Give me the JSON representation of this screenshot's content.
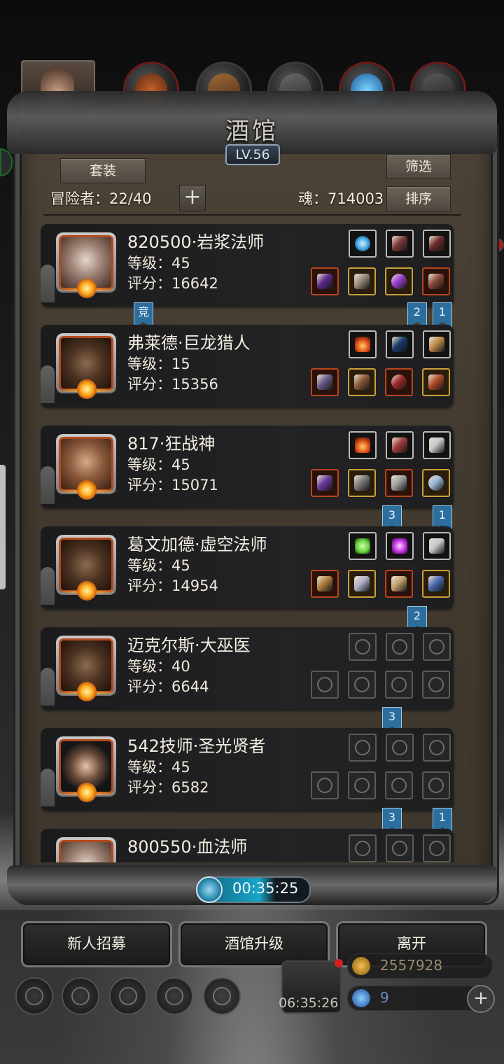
{
  "title": "酒馆",
  "level_badge": "LV.56",
  "buttons": {
    "suit": "套装",
    "filter": "筛选",
    "sort": "排序",
    "plus": "+"
  },
  "stats": {
    "adventurers": "冒险者：22/40",
    "soul": "魂：714003"
  },
  "heroes": [
    {
      "name": "820500·岩浆法师",
      "level": "等级：45",
      "score": "评分：16642",
      "slots_top": [
        {
          "frame": "b",
          "icon": "orb-icon",
          "color": "#3aa0e0"
        },
        {
          "frame": "b",
          "icon": "feather-icon",
          "color": "#7a3a3a"
        },
        {
          "frame": "b",
          "icon": "feather-icon",
          "color": "#6a2a2a"
        }
      ],
      "slots_bottom": [
        {
          "frame": "r",
          "icon": "staff-icon",
          "color": "#5a2a8a"
        },
        {
          "frame": "g",
          "icon": "armor-icon",
          "color": "#9a8a7a"
        },
        {
          "frame": "g",
          "icon": "eye-ring-icon",
          "color": "#9a40d0"
        },
        {
          "frame": "r",
          "icon": "book-icon",
          "color": "#8a4a3a"
        }
      ]
    },
    {
      "name": "弗莱德·巨龙猎人",
      "level": "等级：15",
      "score": "评分：15356",
      "slots_top": [
        {
          "frame": "b",
          "icon": "fire-icon",
          "color": "#e0501a"
        },
        {
          "frame": "b",
          "icon": "bow-icon",
          "color": "#1a3a6a"
        },
        {
          "frame": "b",
          "icon": "bell-icon",
          "color": "#c08a4a"
        }
      ],
      "slots_bottom": [
        {
          "frame": "r",
          "icon": "crossbow-icon",
          "color": "#6a5a8a"
        },
        {
          "frame": "g",
          "icon": "armor-icon",
          "color": "#8a5a3a"
        },
        {
          "frame": "r",
          "icon": "ring-icon",
          "color": "#9a2a2a"
        },
        {
          "frame": "g",
          "icon": "amulet-icon",
          "color": "#b04a2a"
        }
      ]
    },
    {
      "name": "817·狂战神",
      "level": "等级：45",
      "score": "评分：15071",
      "slots_top": [
        {
          "frame": "b",
          "icon": "fire-icon",
          "color": "#e0501a"
        },
        {
          "frame": "b",
          "icon": "feather-icon",
          "color": "#a03a3a"
        },
        {
          "frame": "b",
          "icon": "emblem-icon",
          "color": "#c8c8c8"
        }
      ],
      "slots_bottom": [
        {
          "frame": "r",
          "icon": "axe-icon",
          "color": "#6a3a9a"
        },
        {
          "frame": "g",
          "icon": "armor-icon",
          "color": "#7a7a7a"
        },
        {
          "frame": "r",
          "icon": "helmet-icon",
          "color": "#a0a0a0"
        },
        {
          "frame": "g",
          "icon": "medallion-icon",
          "color": "#9ab8d8"
        }
      ]
    },
    {
      "name": "葛文加德·虚空法师",
      "level": "等级：45",
      "score": "评分：14954",
      "slots_top": [
        {
          "frame": "b",
          "icon": "leaf-icon",
          "color": "#6ad040"
        },
        {
          "frame": "b",
          "icon": "gem-icon",
          "color": "#c030e0"
        },
        {
          "frame": "b",
          "icon": "emblem-icon",
          "color": "#c8c8c8"
        }
      ],
      "slots_bottom": [
        {
          "frame": "r",
          "icon": "staff-icon",
          "color": "#b07a3a"
        },
        {
          "frame": "g",
          "icon": "armor-icon",
          "color": "#b0b0c8"
        },
        {
          "frame": "r",
          "icon": "shield-icon",
          "color": "#c0a070"
        },
        {
          "frame": "g",
          "icon": "wand-icon",
          "color": "#4a6ab0"
        }
      ]
    },
    {
      "name": "迈克尔斯·大巫医",
      "level": "等级：40",
      "score": "评分：6644",
      "slots_top": [
        {
          "frame": "e",
          "icon": "empty-drop-icon"
        },
        {
          "frame": "e",
          "icon": "empty-hourglass-icon"
        },
        {
          "frame": "e",
          "icon": "empty-hourglass-icon"
        }
      ],
      "slots_bottom": [
        {
          "frame": "e",
          "icon": "empty-staff-icon"
        },
        {
          "frame": "e",
          "icon": "empty-armor-icon"
        },
        {
          "frame": "e",
          "icon": "empty-ring-icon"
        },
        {
          "frame": "e",
          "icon": "empty-ring-icon"
        }
      ]
    },
    {
      "name": "542技师·圣光贤者",
      "level": "等级：45",
      "score": "评分：6582",
      "slots_top": [
        {
          "frame": "e",
          "icon": "empty-drop-icon"
        },
        {
          "frame": "e",
          "icon": "empty-hourglass-icon"
        },
        {
          "frame": "e",
          "icon": "empty-hourglass-icon"
        }
      ],
      "slots_bottom": [
        {
          "frame": "e",
          "icon": "empty-hammer-icon"
        },
        {
          "frame": "e",
          "icon": "empty-armor-icon"
        },
        {
          "frame": "e",
          "icon": "empty-ring-icon"
        },
        {
          "frame": "e",
          "icon": "empty-ring-icon"
        }
      ]
    },
    {
      "name": "800550·血法师",
      "level": "",
      "score": "",
      "slots_top": [
        {
          "frame": "e",
          "icon": "empty-drop-icon"
        },
        {
          "frame": "e",
          "icon": "empty-hourglass-icon"
        },
        {
          "frame": "e",
          "icon": "empty-hourglass-icon"
        }
      ],
      "slots_bottom": []
    }
  ],
  "flags": {
    "arena": "竞",
    "f2": "2",
    "f1": "1",
    "f3": "3"
  },
  "timer": "00:35:25",
  "bottom_buttons": {
    "recruit": "新人招募",
    "upgrade": "酒馆升级",
    "leave": "离开"
  },
  "chest_timer": "06:35:26",
  "resources": {
    "gold": "2557928",
    "gems": "9"
  },
  "colors": {
    "panel": "#433b30",
    "card": "#1e1e20",
    "accent_blue": "#2c6f9e",
    "timer_fill": "#18a7c9"
  },
  "timer_progress": 0.55
}
